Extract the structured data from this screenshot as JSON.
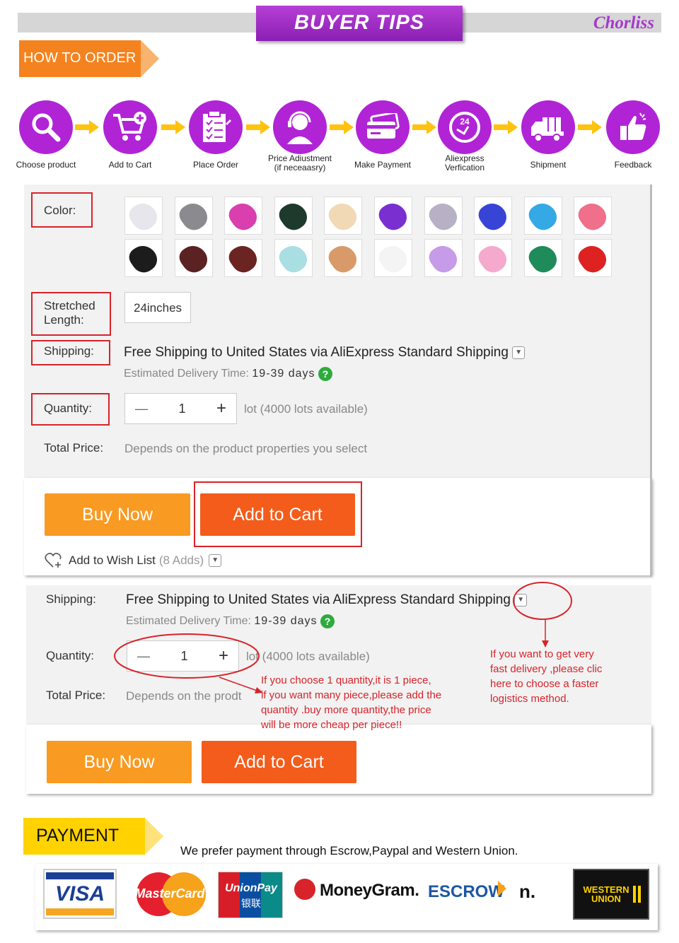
{
  "header": {
    "banner": "BUYER TIPS",
    "brand": "Chorliss"
  },
  "how_to_order": {
    "title": "HOW TO ORDER",
    "steps": [
      {
        "label": "Choose product",
        "icon": "magnifier-icon"
      },
      {
        "label": "Add to Cart",
        "icon": "shopping-cart-add-icon"
      },
      {
        "label": "Place Order",
        "icon": "clipboard-checklist-icon"
      },
      {
        "label": "Price Adiustment",
        "label2": "(if neceaasry)",
        "icon": "customer-service-agent-icon"
      },
      {
        "label": "Make Payment",
        "icon": "credit-card-icon"
      },
      {
        "label": "Aliexpress",
        "label2": "Verfication",
        "icon": "24-hour-clock-icon"
      },
      {
        "label": "Shipment",
        "icon": "delivery-truck-icon"
      },
      {
        "label": "Feedback",
        "icon": "thumbs-up-icon"
      }
    ]
  },
  "product": {
    "color_label": "Color:",
    "colors": [
      "#e6e6ec",
      "#8a8a8f",
      "#d93fae",
      "#1e3a2c",
      "#f1d9b5",
      "#7a2fd1",
      "#b8b0c4",
      "#3844d6",
      "#35a9e6",
      "#f06f8a",
      "#1c1c1c",
      "#5a2222",
      "#6b2421",
      "#a9dfe2",
      "#d99a6a",
      "#f4f4f4",
      "#c69be8",
      "#f4a9cd",
      "#1f8a5a",
      "#de2222"
    ],
    "length_label_1": "Stretched",
    "length_label_2": "Length:",
    "length_value": "24inches",
    "shipping_label": "Shipping:",
    "shipping_text": "Free Shipping to United States via AliExpress Standard Shipping",
    "delivery_label": "Estimated Delivery Time:",
    "delivery_value": "19-39 days",
    "quantity_label": "Quantity:",
    "quantity_value": "1",
    "minus": "—",
    "plus": "+",
    "lots_available": "lot (4000 lots available)",
    "total_label": "Total Price:",
    "total_value": "Depends on the product properties you select",
    "buy_now": "Buy Now",
    "add_to_cart": "Add to Cart",
    "wishlist": "Add to Wish List",
    "wishlist_count": "(8 Adds)"
  },
  "product2": {
    "shipping_label": "Shipping:",
    "shipping_text": "Free Shipping to United States via AliExpress Standard Shipping",
    "delivery_label": "Estimated Delivery Time:",
    "delivery_value": "19-39 days",
    "quantity_label": "Quantity:",
    "quantity_value": "1",
    "minus": "—",
    "plus": "+",
    "lots_available": "lot (4000 lots available)",
    "total_label": "Total Price:",
    "total_value": "Depends on the prodt",
    "buy_now": "Buy Now",
    "add_to_cart": "Add to Cart",
    "note_quantity": [
      "If you choose 1 quantity,it is 1 piece,",
      "if you want many piece,please add the",
      "quantity .buy more quantity,the price",
      "will be more cheap per piece!!"
    ],
    "note_shipping": [
      "If you want to get very",
      "fast delivery ,please clic",
      "here to choose a faster",
      "logistics method."
    ]
  },
  "payment": {
    "title": "PAYMENT",
    "text": "We prefer payment through Escrow,Paypal and Western Union.",
    "logos": {
      "visa": "VISA",
      "mastercard": "MasterCard",
      "unionpay": "UnionPay",
      "unionpay_cn": "银联",
      "moneygram": "MoneyGram.",
      "escrow": "ESCROW",
      "n": "n.",
      "western_union": "WESTERN UNION"
    }
  },
  "colors": {
    "purple": "#b024d6",
    "orange": "#f4831f",
    "buy": "#f99a22",
    "cart": "#f35c1b",
    "red": "#d8232a"
  }
}
